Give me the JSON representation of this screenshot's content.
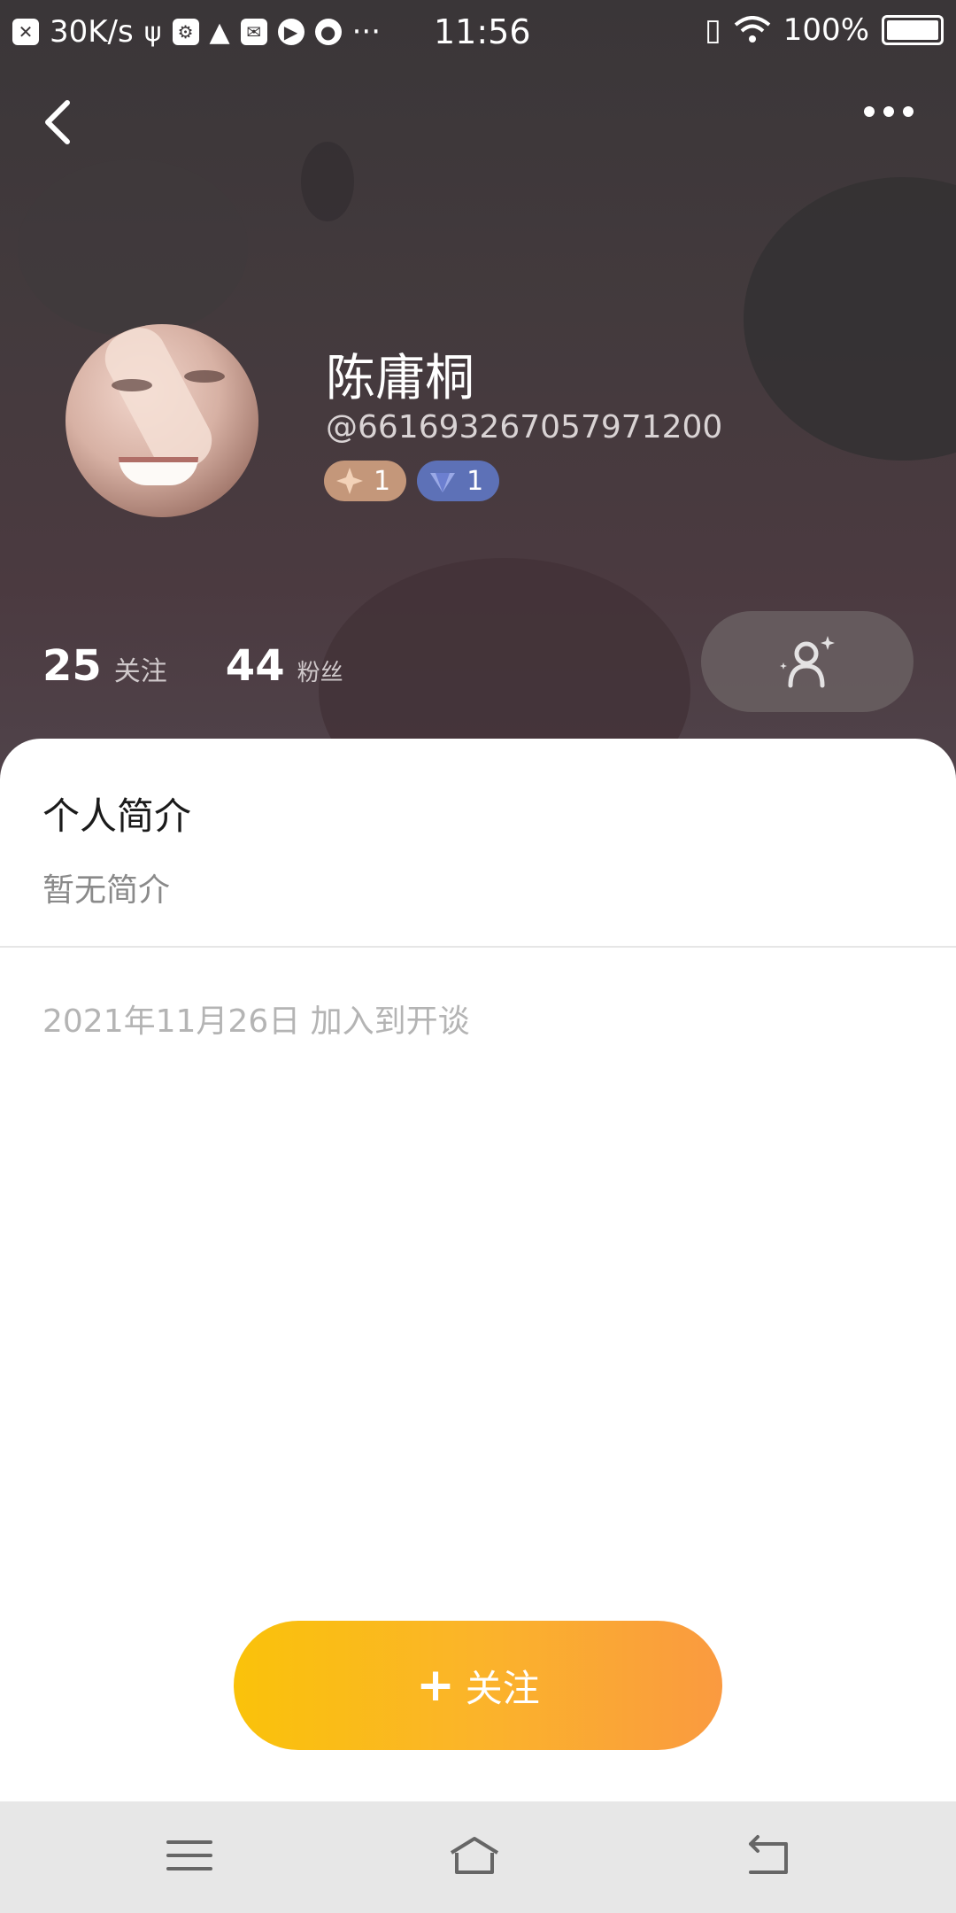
{
  "status_bar": {
    "net_speed": "30K/s",
    "time": "11:56",
    "battery": "100%",
    "left_icons": [
      "close-box-icon",
      "usb-icon",
      "usb-debug-icon",
      "warning-icon",
      "mail-icon",
      "play-icon",
      "planet-icon"
    ]
  },
  "header": {
    "back_icon": "chevron-left-icon",
    "more_icon": "more-dots-icon"
  },
  "profile": {
    "name": "陈庸桐",
    "user_id": "@661693267057971200",
    "badges": [
      {
        "icon": "star-gem-icon",
        "level": "1",
        "color": "#c4977a"
      },
      {
        "icon": "diamond-icon",
        "level": "1",
        "color": "#5d71b7"
      }
    ]
  },
  "stats": {
    "following_count": "25",
    "following_label": "关注",
    "followers_count": "44",
    "followers_label": "粉丝"
  },
  "intro": {
    "title": "个人简介",
    "text": "暂无简介"
  },
  "joined": "2021年11月26日 加入到开谈",
  "follow_button": {
    "plus": "+",
    "label": "关注"
  },
  "colors": {
    "accent_start": "#fac20a",
    "accent_end": "#fa9a40"
  }
}
